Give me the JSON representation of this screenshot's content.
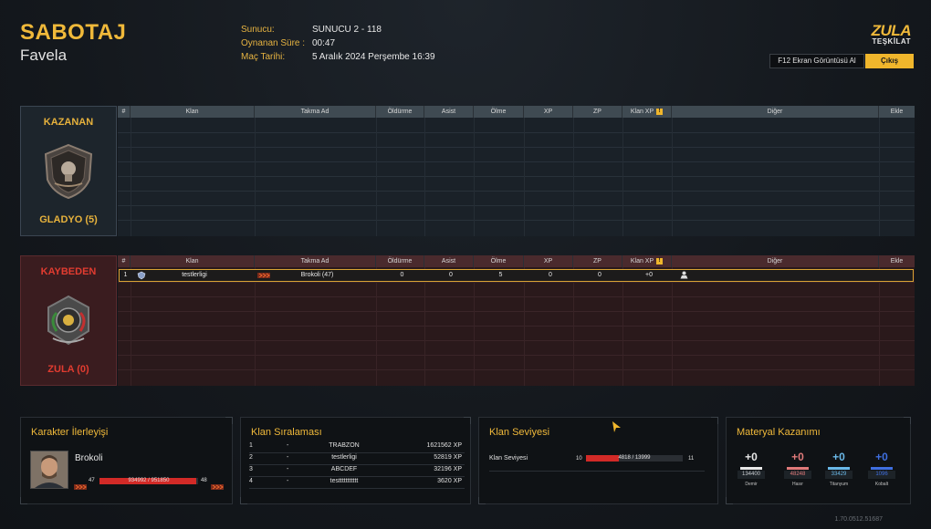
{
  "header": {
    "mode": "SABOTAJ",
    "map": "Favela",
    "server_label": "Sunucu:",
    "server": "SUNUCU 2 - 118",
    "duration_label": "Oynanan Süre :",
    "duration": "00:47",
    "date_label": "Maç Tarihi:",
    "date": "5 Aralık 2024 Perşembe 16:39"
  },
  "logo": {
    "main": "ZULA",
    "sub": "TEŞKİLAT"
  },
  "buttons": {
    "screenshot": "F12 Ekran Görüntüsü Al",
    "exit": "Çıkış"
  },
  "columns": [
    "#",
    "Klan",
    "Takma Ad",
    "Öldürme",
    "Asist",
    "Ölme",
    "XP",
    "ZP",
    "Klan XP",
    "Diğer",
    "Ekle"
  ],
  "winner": {
    "result": "KAZANAN",
    "team": "GLADYO (5)"
  },
  "loser": {
    "result": "KAYBEDEN",
    "team": "ZULA (0)",
    "row": {
      "num": "1",
      "clan": "testlerligi",
      "nick": "Brokoli (47)",
      "kills": "0",
      "assists": "0",
      "deaths": "5",
      "xp": "0",
      "zp": "0",
      "clanxp": "+0"
    }
  },
  "character": {
    "title": "Karakter İlerleyişi",
    "name": "Brokoli",
    "level": "47",
    "xp": "934992 / 951850",
    "next_level": "48",
    "progress": 0.982
  },
  "ranking": {
    "title": "Klan Sıralaması",
    "rows": [
      {
        "pos": "1",
        "dash": "-",
        "clan": "TRABZON",
        "xp": "1621562 XP"
      },
      {
        "pos": "2",
        "dash": "-",
        "clan": "testlerligi",
        "xp": "52819 XP"
      },
      {
        "pos": "3",
        "dash": "-",
        "clan": "ABCDEF",
        "xp": "32196 XP"
      },
      {
        "pos": "4",
        "dash": "-",
        "clan": "testtttttttttt",
        "xp": "3620 XP"
      }
    ]
  },
  "clan_level": {
    "title": "Klan Seviyesi",
    "label": "Klan Seviyesi",
    "level": "10",
    "xp": "4818 / 13999",
    "next": "11",
    "progress": 0.344
  },
  "materials": {
    "title": "Materyal Kazanımı",
    "items": [
      {
        "gain": "+0",
        "value": "134400",
        "name": "Demir",
        "color": "#e8e8e8"
      },
      {
        "gain": "+0",
        "value": "48248",
        "name": "Hasır",
        "color": "#e07a7a"
      },
      {
        "gain": "+0",
        "value": "33429",
        "name": "Titanyum",
        "color": "#6ab8e8"
      },
      {
        "gain": "+0",
        "value": "1096",
        "name": "Kobalt",
        "color": "#3f6fe0"
      }
    ]
  },
  "version": "1.70.0512.51687"
}
